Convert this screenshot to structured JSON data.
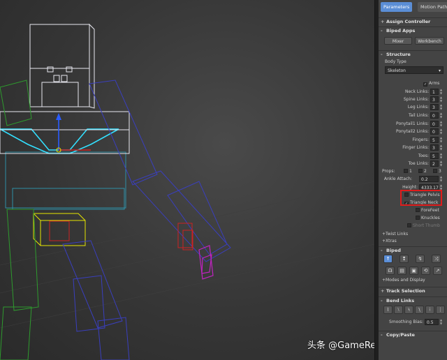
{
  "tabs": [
    {
      "label": "Parameters",
      "active": true
    },
    {
      "label": "Motion Paths",
      "active": false
    }
  ],
  "rollouts": {
    "assign_controller": "Assign Controller",
    "biped_apps": "Biped Apps",
    "structure": "Structure",
    "biped": "Biped",
    "track_selection": "Track Selection",
    "bend_links": "Bend Links",
    "copy_paste": "Copy/Paste"
  },
  "biped_apps": {
    "mixer": "Mixer",
    "workbench": "Workbench"
  },
  "structure": {
    "body_type_label": "Body Type",
    "body_type_value": "Skeleton",
    "arms": {
      "label": "Arms",
      "checked": true
    },
    "fields": [
      {
        "label": "Neck Links:",
        "value": "1"
      },
      {
        "label": "Spine Links:",
        "value": "3"
      },
      {
        "label": "Leg Links:",
        "value": "3"
      },
      {
        "label": "Tail Links:",
        "value": "0"
      },
      {
        "label": "Ponytail1 Links:",
        "value": "0"
      },
      {
        "label": "Ponytail2 Links:",
        "value": "0"
      },
      {
        "label": "Fingers:",
        "value": "5"
      },
      {
        "label": "Finger Links:",
        "value": "3"
      },
      {
        "label": "Toes:",
        "value": "5"
      },
      {
        "label": "Toe Links:",
        "value": "2"
      }
    ],
    "props_label": "Props:",
    "props": [
      "1",
      "2",
      "3"
    ],
    "ankle_attach_label": "Ankle Attach:",
    "ankle_attach_value": "0.2",
    "height_label": "Height:",
    "height_value": "4333.17",
    "triangle_pelvis": {
      "label": "Triangle Pelvis",
      "checked": false
    },
    "triangle_neck": {
      "label": "Triangle Neck",
      "checked": true
    },
    "forefeet": {
      "label": "ForeFeet",
      "checked": false
    },
    "knuckles": {
      "label": "Knuckles",
      "checked": false
    },
    "short_thumb": {
      "label": "Short Thumb",
      "checked": false
    },
    "twist_links": "Twist Links",
    "xtras": "Xtras"
  },
  "biped": {
    "modes_and_display": "Modes and Display"
  },
  "bend_links": {
    "smoothing_bias_label": "Smoothing Bias:",
    "smoothing_bias_value": "0.5"
  },
  "watermark": "头条 @GameRes游资网",
  "colors": {
    "accent": "#5b8ed6",
    "highlight": "#e01b1b",
    "selected_bone": "#33e0ff"
  }
}
